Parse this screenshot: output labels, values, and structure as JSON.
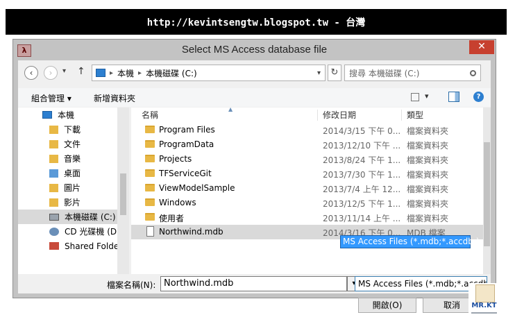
{
  "banner": {
    "text": "http://kevintsengtw.blogspot.tw - 台灣"
  },
  "window": {
    "title": "Select MS Access database file",
    "close": "✕",
    "app_icon": "λ"
  },
  "address": {
    "segments": [
      "本機",
      "本機磁碟 (C:)"
    ],
    "sep": "▸",
    "back": "‹",
    "forward": "›",
    "recent": "▾",
    "up": "↑",
    "refresh": "↻",
    "dropdown": "▾"
  },
  "search": {
    "placeholder": "搜尋 本機磁碟 (C:)"
  },
  "toolbar": {
    "organize": "組合管理 ▾",
    "new_folder": "新增資料夾",
    "view": "▾",
    "help": "?"
  },
  "nav": {
    "items": [
      {
        "label": "本機",
        "icon": "computer-icon"
      },
      {
        "label": "下載",
        "icon": "download-folder-icon"
      },
      {
        "label": "文件",
        "icon": "documents-folder-icon"
      },
      {
        "label": "音樂",
        "icon": "music-folder-icon"
      },
      {
        "label": "桌面",
        "icon": "desktop-folder-icon"
      },
      {
        "label": "圖片",
        "icon": "pictures-folder-icon"
      },
      {
        "label": "影片",
        "icon": "videos-folder-icon"
      },
      {
        "label": "本機磁碟 (C:)",
        "icon": "drive-icon"
      },
      {
        "label": "CD 光碟機 (D:)",
        "icon": "cd-drive-icon"
      },
      {
        "label": "Shared Folder",
        "icon": "shared-folder-icon"
      }
    ],
    "selected": 7
  },
  "files": {
    "headers": [
      "名稱",
      "修改日期",
      "類型"
    ],
    "rows": [
      {
        "name": "Program Files",
        "date": "2014/3/15 下午 0...",
        "type": "檔案資料夾",
        "kind": "folder"
      },
      {
        "name": "ProgramData",
        "date": "2013/12/10 下午 ...",
        "type": "檔案資料夾",
        "kind": "folder"
      },
      {
        "name": "Projects",
        "date": "2013/8/24 下午 1...",
        "type": "檔案資料夾",
        "kind": "folder"
      },
      {
        "name": "TFServiceGit",
        "date": "2013/7/30 下午 1...",
        "type": "檔案資料夾",
        "kind": "folder"
      },
      {
        "name": "ViewModelSample",
        "date": "2013/7/4 上午 12...",
        "type": "檔案資料夾",
        "kind": "folder"
      },
      {
        "name": "Windows",
        "date": "2013/12/5 下午 1...",
        "type": "檔案資料夾",
        "kind": "folder"
      },
      {
        "name": "使用者",
        "date": "2013/11/14 上午 ...",
        "type": "檔案資料夾",
        "kind": "folder"
      },
      {
        "name": "Northwind.mdb",
        "date": "2014/3/16 下午 0...",
        "type": "MDB 檔案",
        "kind": "file"
      }
    ],
    "selected": 7
  },
  "bottom": {
    "filename_label": "檔案名稱(N):",
    "filename_value": "Northwind.mdb",
    "type_value": "MS Access Files (*.mdb;*.accdb;)",
    "type_option": "MS Access Files (*.mdb;*.accdb;)",
    "open": "開啟(O)",
    "cancel": "取消"
  },
  "logo": {
    "text": "MR.KT"
  }
}
